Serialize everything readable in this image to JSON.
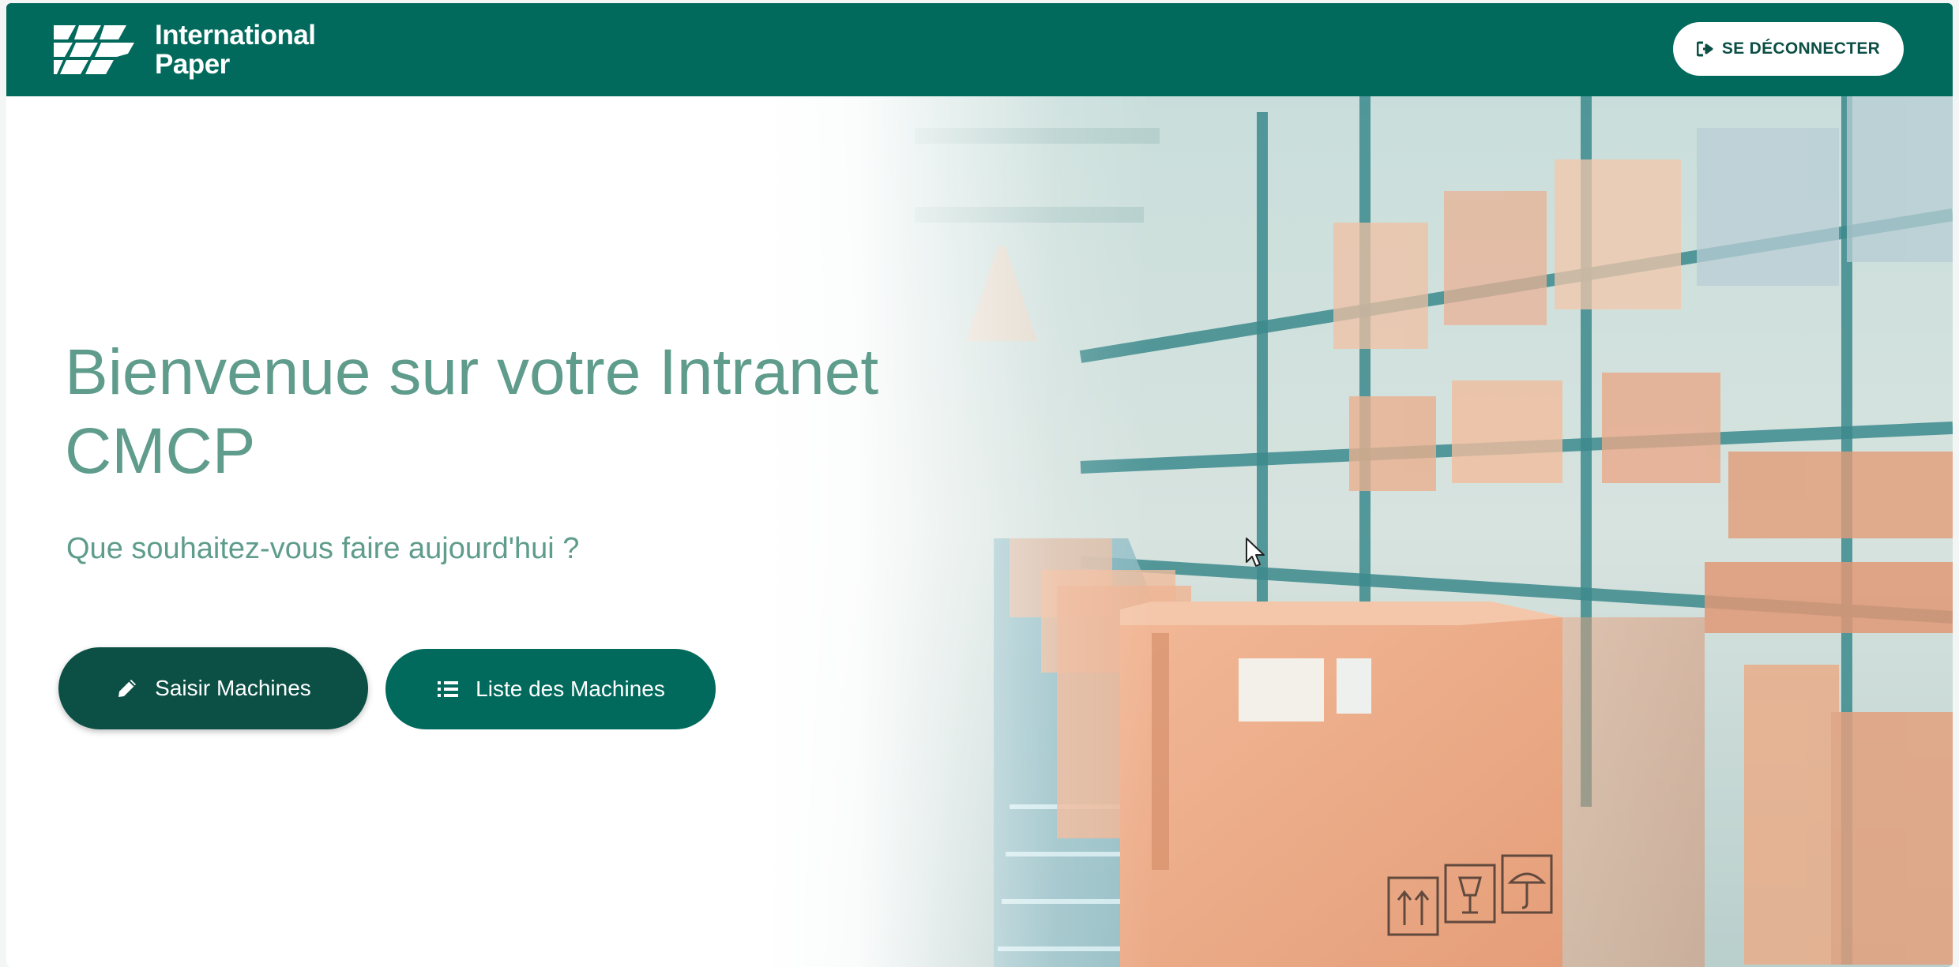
{
  "header": {
    "logo_text_line1": "International",
    "logo_text_line2": "Paper",
    "logout_label": "SE DÉCONNECTER",
    "logout_icon": "sign-out-icon",
    "brand_color": "#016a5c"
  },
  "hero": {
    "title": "Bienvenue sur votre Intranet CMCP",
    "subtitle": "Que souhaitez-vous faire aujourd'hui ?",
    "buttons": [
      {
        "label": "Saisir Machines",
        "icon": "pencil-icon",
        "color": "#0b4f45"
      },
      {
        "label": "Liste des Machines",
        "icon": "list-icon",
        "color": "#016a5c"
      }
    ]
  }
}
